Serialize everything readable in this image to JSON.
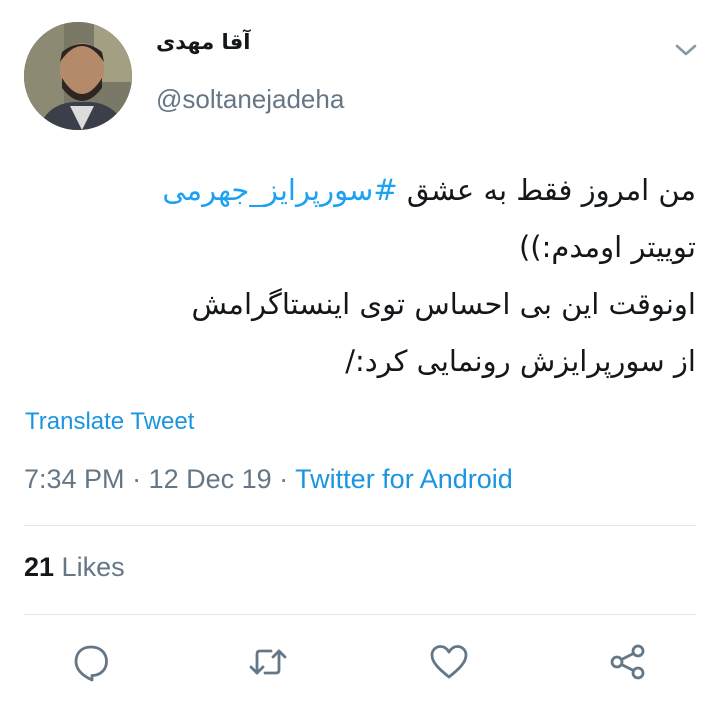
{
  "tweet": {
    "display_name": "آقا مهدی",
    "handle": "@soltanejadeha",
    "body": {
      "line1_text": "من امروز فقط به عشق ",
      "line1_hashtag": "#سورپرایز_جهرمی",
      "line2": "توییتر اومدم:))",
      "line3": "اونوقت این بی احساس توی اینستاگرامش",
      "line4": "از سورپرایزش رونمایی کرد:/"
    },
    "translate_label": "Translate Tweet",
    "time": "7:34 PM",
    "separator": " · ",
    "date": "12 Dec 19",
    "source": "Twitter for Android",
    "likes_count": "21",
    "likes_label": " Likes"
  },
  "icons": {
    "caret": "chevron-down-icon",
    "reply": "reply-icon",
    "retweet": "retweet-icon",
    "like": "heart-icon",
    "share": "share-icon"
  },
  "colors": {
    "link_blue": "#1b95e0",
    "hashtag_blue": "#1da1f2",
    "secondary_text": "#657786",
    "primary_text": "#14171a",
    "divider": "#e1e8ed"
  }
}
